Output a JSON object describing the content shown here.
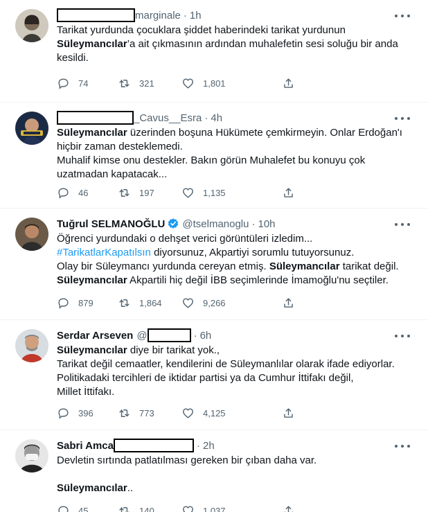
{
  "tweets": [
    {
      "name": "",
      "handle_suffix": "marginale",
      "time": "1h",
      "lines": [
        [
          {
            "t": "Tarikat yurdunda çocuklara şiddet haberindeki tarikat yurdunun"
          }
        ],
        [
          {
            "t": "Süleymancılar",
            "b": true
          },
          {
            "t": "’a ait çıkmasının ardından muhalefetin sesi soluğu bir anda"
          }
        ],
        [
          {
            "t": "kesildi."
          }
        ]
      ],
      "replies": "74",
      "retweets": "321",
      "likes": "1,801"
    },
    {
      "name": "",
      "handle_suffix": "_Cavus__Esra",
      "time": "4h",
      "lines": [
        [
          {
            "t": "Süleymancılar",
            "b": true
          },
          {
            "t": " üzerinden boşuna Hükümete çemkirmeyin. Onlar Erdoğan'ı"
          }
        ],
        [
          {
            "t": "hiçbir zaman desteklemedi."
          }
        ],
        [
          {
            "t": "Muhalif kimse onu destekler. Bakın görün Muhalefet bu konuyu çok"
          }
        ],
        [
          {
            "t": "uzatmadan kapatacak..."
          }
        ]
      ],
      "replies": "46",
      "retweets": "197",
      "likes": "1,135"
    },
    {
      "name": "Tuğrul SELMANOĞLU",
      "handle_suffix": "@tselmanoglu",
      "time": "10h",
      "lines": [
        [
          {
            "t": "Öğrenci yurdundaki o dehşet verici görüntüleri izledim..."
          }
        ],
        [
          {
            "t": "#TarikatlarKapatılsın",
            "link": true
          },
          {
            "t": " diyorsunuz, Akpartiyi sorumlu tutuyorsunuz."
          }
        ],
        [
          {
            "t": "Olay bir Süleymancı yurdunda cereyan etmiş. "
          },
          {
            "t": "Süleymancılar",
            "b": true
          },
          {
            "t": " tarikat değil."
          }
        ],
        [
          {
            "t": "Süleymancılar",
            "b": true
          },
          {
            "t": " Akpartili hiç değil İBB seçimlerinde İmamoğlu'nu seçtiler."
          }
        ]
      ],
      "replies": "879",
      "retweets": "1,864",
      "likes": "9,266"
    },
    {
      "name": "Serdar Arseven",
      "handle_suffix": "@",
      "time": "6h",
      "lines": [
        [
          {
            "t": "Süleymancılar",
            "b": true
          },
          {
            "t": " diye bir tarikat yok.,"
          }
        ],
        [
          {
            "t": "Tarikat değil cemaatler, kendilerini de Süleymanlılar olarak ifade ediyorlar."
          }
        ],
        [
          {
            "t": "Politikadaki tercihleri de iktidar partisi ya da Cumhur İttifakı değil,"
          }
        ],
        [
          {
            "t": " Millet İttifakı."
          }
        ]
      ],
      "replies": "396",
      "retweets": "773",
      "likes": "4,125"
    },
    {
      "name": "Sabri Amca",
      "handle_suffix": "",
      "time": "2h",
      "lines": [
        [
          {
            "t": "Devletin sırtında patlatılması gereken bir çıban daha var."
          }
        ],
        [
          {
            "t": " "
          }
        ],
        [
          {
            "t": "Süleymancılar",
            "b": true
          },
          {
            "t": ".."
          }
        ]
      ],
      "replies": "45",
      "retweets": "140",
      "likes": "1,037"
    }
  ]
}
